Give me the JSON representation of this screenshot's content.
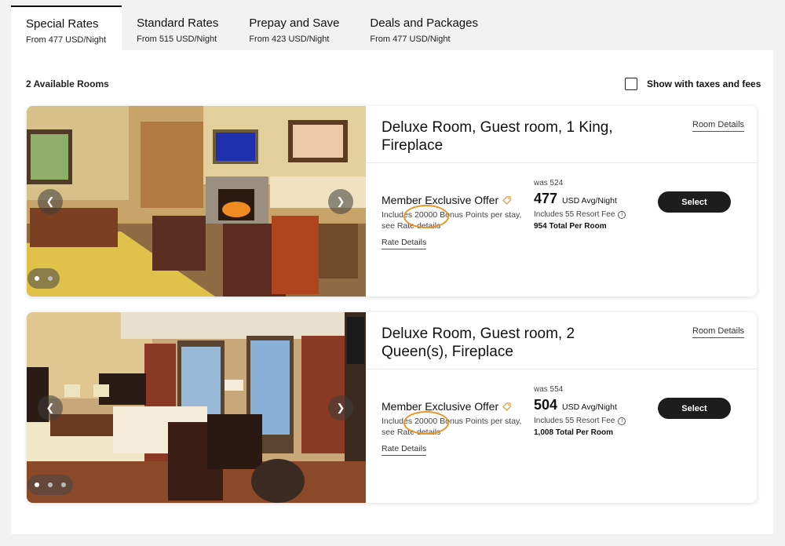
{
  "tabs": [
    {
      "title": "Special Rates",
      "sub": "From 477 USD/Night",
      "active": true
    },
    {
      "title": "Standard Rates",
      "sub": "From 515 USD/Night"
    },
    {
      "title": "Prepay and Save",
      "sub": "From 423 USD/Night"
    },
    {
      "title": "Deals and Packages",
      "sub": "From 477 USD/Night"
    }
  ],
  "available_rooms": "2 Available Rooms",
  "taxes_toggle": {
    "label": "Show with taxes and fees",
    "checked": false
  },
  "colors": {
    "accent_ring": "#e8952a",
    "button": "#1d1d1d",
    "tag": "#e8952a"
  },
  "icons": {
    "prev": "chevron-left-icon",
    "next": "chevron-right-icon",
    "tag": "tag-icon",
    "info": "info-icon"
  },
  "rooms": [
    {
      "title": "Deluxe Room, Guest room, 1 King, Fireplace",
      "room_details": "Room Details",
      "offer_title": "Member Exclusive Offer",
      "offer_pre": "Includes ",
      "offer_points": "20000",
      "offer_post": " Bonus Points per stay, see Rate details",
      "rate_details": "Rate Details",
      "was": "was 524",
      "price": "477",
      "unit": "USD Avg/Night",
      "fee": "Includes 55 Resort Fee",
      "total": "954 Total Per Room",
      "select": "Select",
      "photo_count": 2,
      "photo_active": 0
    },
    {
      "title": "Deluxe Room, Guest room, 2 Queen(s), Fireplace",
      "room_details": "Room Details",
      "offer_title": "Member Exclusive Offer",
      "offer_pre": "Includes ",
      "offer_points": "20000",
      "offer_post": " Bonus Points per stay, see Rate details",
      "rate_details": "Rate Details",
      "was": "was 554",
      "price": "504",
      "unit": "USD Avg/Night",
      "fee": "Includes 55 Resort Fee",
      "total": "1,008 Total Per Room",
      "select": "Select",
      "photo_count": 3,
      "photo_active": 0
    }
  ]
}
